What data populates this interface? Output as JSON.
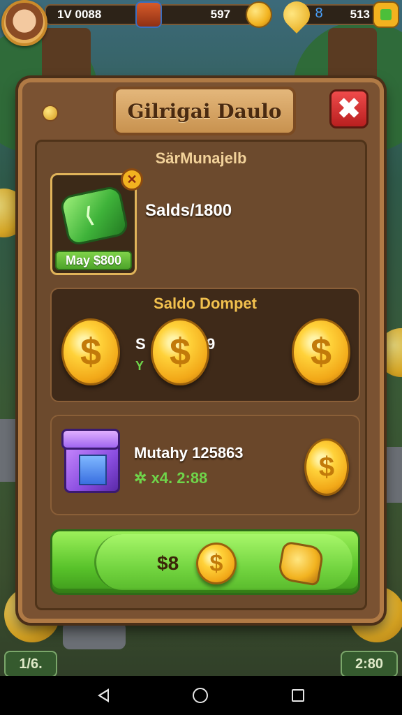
{
  "hud": {
    "level_text": "1V 0088",
    "coins_text": "597",
    "gems_icon_text": "8",
    "gems_text": "513"
  },
  "dialog": {
    "title": "Gilrigai Daulo",
    "close_glyph": "✖",
    "subtitle": "SärMunajelb",
    "item": {
      "remove_glyph": "✕",
      "price_label": "May $800",
      "balance_label": "Salds/1800"
    },
    "wallet": {
      "title": "Saldo Dompet",
      "value_prefix": "S",
      "value_suffix": "9",
      "sub_glyph": "Y"
    },
    "bundle": {
      "name": "Mutahy 125863",
      "bonus_glyph": "✲",
      "bonus_text": "x4. 2:88"
    },
    "buy_button": {
      "price": "$8"
    },
    "coin_glyph": "$"
  },
  "bottom": {
    "left_badge": "1/6.",
    "right_badge": "2:80"
  }
}
